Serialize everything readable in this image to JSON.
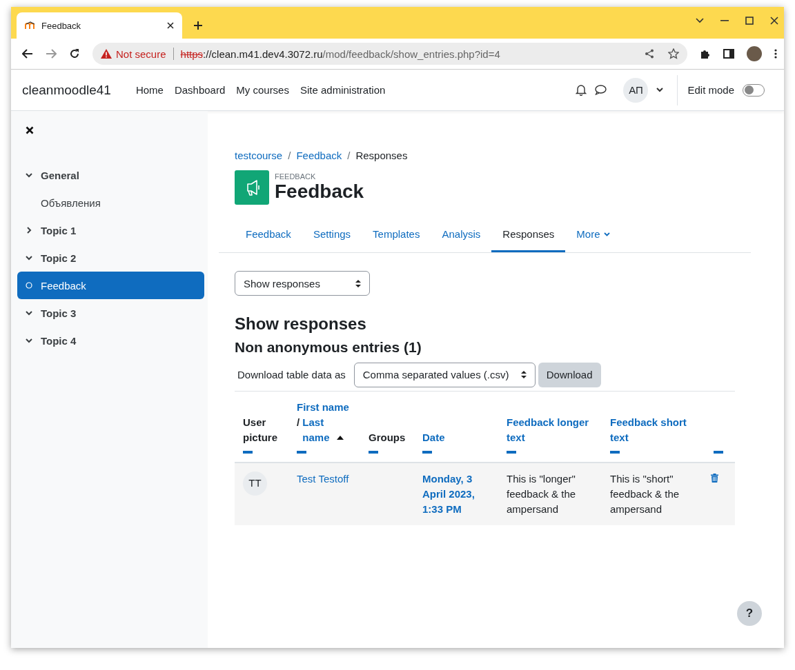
{
  "browser": {
    "tab_title": "Feedback",
    "security": "Not secure",
    "url_scheme": "https",
    "url_host": "://clean.m41.dev4.3072.ru",
    "url_path": "/mod/feedback/show_entries.php?id=4"
  },
  "navbar": {
    "site_name": "cleanmoodle41",
    "links": [
      "Home",
      "Dashboard",
      "My courses",
      "Site administration"
    ],
    "user_initials": "АП",
    "edit_mode_label": "Edit mode",
    "edit_mode_on": false
  },
  "sidebar": {
    "items": [
      {
        "kind": "section",
        "label": "General",
        "expanded": true,
        "selected": false
      },
      {
        "kind": "activity",
        "label": "Объявления",
        "selected": false
      },
      {
        "kind": "section",
        "label": "Topic 1",
        "expanded": false,
        "selected": false
      },
      {
        "kind": "section",
        "label": "Topic 2",
        "expanded": true,
        "selected": false
      },
      {
        "kind": "activity",
        "label": "Feedback",
        "selected": true
      },
      {
        "kind": "section",
        "label": "Topic 3",
        "expanded": true,
        "selected": false
      },
      {
        "kind": "section",
        "label": "Topic 4",
        "expanded": true,
        "selected": false
      }
    ]
  },
  "breadcrumb": [
    {
      "label": "testcourse",
      "link": true
    },
    {
      "separator": "/",
      "label": "Feedback",
      "link": true
    },
    {
      "separator": "/",
      "label": "Responses",
      "link": false
    }
  ],
  "page_header": {
    "module_type": "FEEDBACK",
    "title": "Feedback"
  },
  "tabs": [
    {
      "label": "Feedback",
      "selected": false
    },
    {
      "label": "Settings",
      "selected": false
    },
    {
      "label": "Templates",
      "selected": false
    },
    {
      "label": "Analysis",
      "selected": false
    },
    {
      "label": "Responses",
      "selected": true
    },
    {
      "label": "More",
      "selected": false
    }
  ],
  "view_select": {
    "value": "Show responses"
  },
  "heading": "Show responses",
  "subheading": "Non anonymous entries (1)",
  "download": {
    "label": "Download table data as",
    "format": "Comma separated values (.csv)",
    "button": "Download"
  },
  "table": {
    "columns": [
      {
        "kind": "plain",
        "label": "User picture"
      },
      {
        "kind": "name",
        "first": "First name",
        "separator": "/",
        "last": "Last name",
        "sorted": true
      },
      {
        "kind": "plain",
        "label": "Groups"
      },
      {
        "kind": "link",
        "label": "Date"
      },
      {
        "kind": "link",
        "label": "Feedback longer text"
      },
      {
        "kind": "link",
        "label": "Feedback short text"
      },
      {
        "kind": "empty"
      }
    ],
    "rows": [
      {
        "initials": "TT",
        "name": "Test Testoff",
        "date": "Monday, 3 April 2023, 1:33 PM",
        "longer": "This is \"longer\" feedback & the ampersand",
        "short": "This is \"short\" feedback & the ampersand"
      }
    ]
  },
  "help_button": "?"
}
